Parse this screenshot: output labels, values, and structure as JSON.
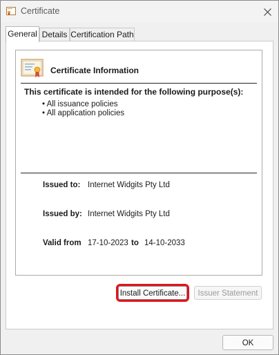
{
  "window": {
    "title": "Certificate"
  },
  "tabs": [
    {
      "label": "General"
    },
    {
      "label": "Details"
    },
    {
      "label": "Certification Path"
    }
  ],
  "info": {
    "heading": "Certificate Information",
    "purpose_title": "This certificate is intended for the following purpose(s):",
    "policies": [
      "• All issuance policies",
      "• All application policies"
    ],
    "issued_to_label": "Issued to:",
    "issued_to_value": "Internet Widgits Pty Ltd",
    "issued_by_label": "Issued by:",
    "issued_by_value": "Internet Widgits Pty Ltd",
    "valid_from_label": "Valid from",
    "valid_from_value": "17-10-2023",
    "valid_to_label": "to",
    "valid_to_value": "14-10-2033"
  },
  "buttons": {
    "install": "Install Certificate...",
    "issuer_statement": "Issuer Statement",
    "ok": "OK"
  },
  "colors": {
    "highlight": "#e0141b"
  }
}
